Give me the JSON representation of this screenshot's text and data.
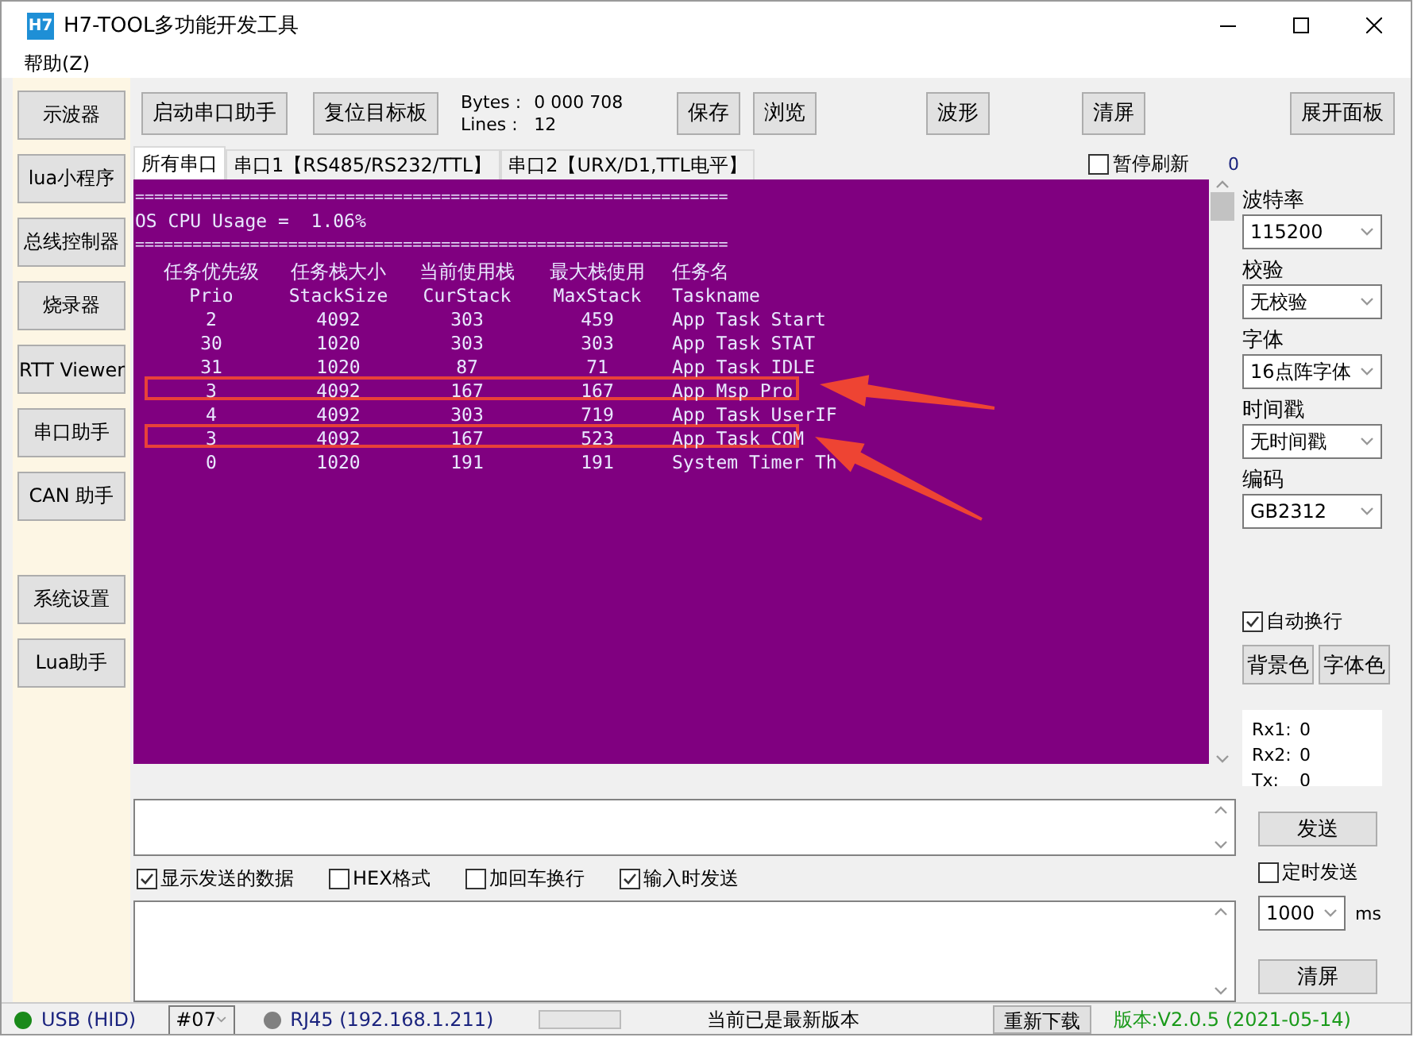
{
  "window": {
    "title": "H7-TOOL多功能开发工具",
    "logo": "H7"
  },
  "menu": [
    "帮助(Z)"
  ],
  "sidebar": {
    "tools": [
      "示波器",
      "lua小程序",
      "总线控制器",
      "烧录器",
      "RTT Viewer",
      "串口助手",
      "CAN 助手"
    ],
    "settings": [
      "系统设置",
      "Lua助手"
    ]
  },
  "toolbar": {
    "buttons_left": [
      "启动串口助手",
      "复位目标板"
    ],
    "stats": [
      {
        "label": "Bytes :",
        "value": "0 000 708"
      },
      {
        "label": "Lines :",
        "value": "12"
      }
    ],
    "buttons_right": [
      "保存",
      "浏览",
      "波形",
      "清屏",
      "展开面板"
    ]
  },
  "tabs": [
    {
      "label": "所有串口",
      "selected": true
    },
    {
      "label": "串口1【RS485/RS232/TTL】",
      "selected": false
    },
    {
      "label": "串口2【URX/D1,TTL电平】",
      "selected": false
    }
  ],
  "pause_refresh": {
    "label": "暂停刷新",
    "checked": false
  },
  "counter": "0",
  "terminal": {
    "separator": "==============================================================",
    "cpu_usage": "OS CPU Usage =  1.06%",
    "columns_cn": [
      "任务优先级",
      "任务栈大小",
      "当前使用栈",
      "最大栈使用",
      "任务名"
    ],
    "columns_en": [
      "Prio",
      "StackSize",
      "CurStack",
      "MaxStack",
      "Taskname"
    ],
    "rows": [
      {
        "cells": [
          "2",
          "4092",
          "303",
          "459",
          "App Task Start"
        ],
        "highlighted": false
      },
      {
        "cells": [
          "30",
          "1020",
          "303",
          "303",
          "App Task STAT"
        ],
        "highlighted": false
      },
      {
        "cells": [
          "31",
          "1020",
          "87",
          "71",
          "App Task IDLE"
        ],
        "highlighted": false
      },
      {
        "cells": [
          "3",
          "4092",
          "167",
          "167",
          "App Msp Pro"
        ],
        "highlighted": true
      },
      {
        "cells": [
          "4",
          "4092",
          "303",
          "719",
          "App Task UserIF"
        ],
        "highlighted": false
      },
      {
        "cells": [
          "3",
          "4092",
          "167",
          "523",
          "App Task COM"
        ],
        "highlighted": true
      },
      {
        "cells": [
          "0",
          "1020",
          "191",
          "191",
          "System Timer Th"
        ],
        "highlighted": false
      }
    ]
  },
  "settings": [
    {
      "label": "波特率",
      "value": "115200"
    },
    {
      "label": "校验",
      "value": "无校验"
    },
    {
      "label": "字体",
      "value": "16点阵字体"
    },
    {
      "label": "时间戳",
      "value": "无时间戳"
    },
    {
      "label": "编码",
      "value": "GB2312"
    }
  ],
  "auto_wrap": {
    "label": "自动换行",
    "checked": true
  },
  "color_buttons": [
    "背景色",
    "字体色"
  ],
  "counters": [
    {
      "label": "Rx1:",
      "value": "0"
    },
    {
      "label": "Rx2:",
      "value": "0"
    },
    {
      "label": "Tx:",
      "value": "0"
    }
  ],
  "send_button": "发送",
  "send_options": [
    {
      "label": "显示发送的数据",
      "checked": true
    },
    {
      "label": "HEX格式",
      "checked": false
    },
    {
      "label": "加回车换行",
      "checked": false
    },
    {
      "label": "输入时发送",
      "checked": true
    }
  ],
  "timed_send": {
    "label": "定时发送",
    "checked": false
  },
  "interval": {
    "value": "1000",
    "unit": "ms"
  },
  "clear_button": "清屏",
  "status_bar": {
    "connections": [
      {
        "label": "USB (HID)",
        "color": "#1a8a1a"
      },
      {
        "label": "RJ45 (192.168.1.211)",
        "color": "#808080"
      }
    ],
    "port": "#07",
    "progress": {
      "level": 0
    },
    "message": "当前已是最新版本",
    "redownload": "重新下载",
    "version": "版本:V2.0.5 (2021-05-14)"
  }
}
